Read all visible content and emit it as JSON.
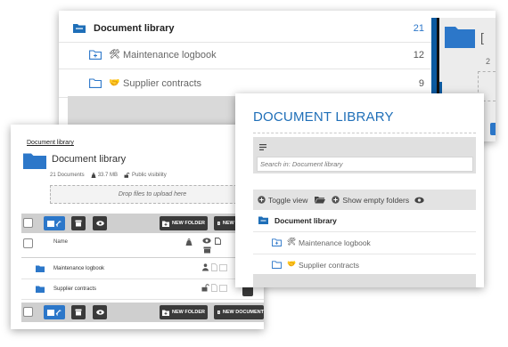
{
  "colors": {
    "accent": "#2c77c9",
    "title_blue": "#1f6fb8",
    "toolbar_gray": "#cfcfcf",
    "dark_button": "#3a3a3a"
  },
  "top_panel": {
    "rows": [
      {
        "label": "Document library",
        "count": "21",
        "icon": "folder-open-icon"
      },
      {
        "label": "Maintenance logbook",
        "count": "12",
        "icon": "folder-plus-icon",
        "emoji": "🛠"
      },
      {
        "label": "Supplier contracts",
        "count": "9",
        "icon": "folder-icon",
        "emoji": "🤝"
      }
    ],
    "partial_title_fragment": "[",
    "partial_meta_fragment": "2"
  },
  "left_panel": {
    "breadcrumb": "Document library",
    "title": "Document library",
    "meta": {
      "documents": "21 Documents",
      "size": "33.7 MB",
      "visibility": "Public visibility"
    },
    "dropzone": "Drop files to upload here",
    "toolbar": {
      "new_folder": "NEW FOLDER",
      "new_document": "NEW DOCUMENT"
    },
    "table_header": {
      "name": "Name"
    },
    "rows": [
      {
        "name": "Maintenance logbook"
      },
      {
        "name": "Supplier contracts"
      }
    ]
  },
  "right_panel": {
    "title": "DOCUMENT LIBRARY",
    "search_placeholder": "Search in: Document library",
    "toolbar": {
      "toggle_view": "Toggle view",
      "show_empty": "Show empty folders"
    },
    "rows": [
      {
        "label": "Document library"
      },
      {
        "label": "Maintenance logbook",
        "emoji": "🛠"
      },
      {
        "label": "Supplier contracts",
        "emoji": "🤝"
      }
    ]
  }
}
